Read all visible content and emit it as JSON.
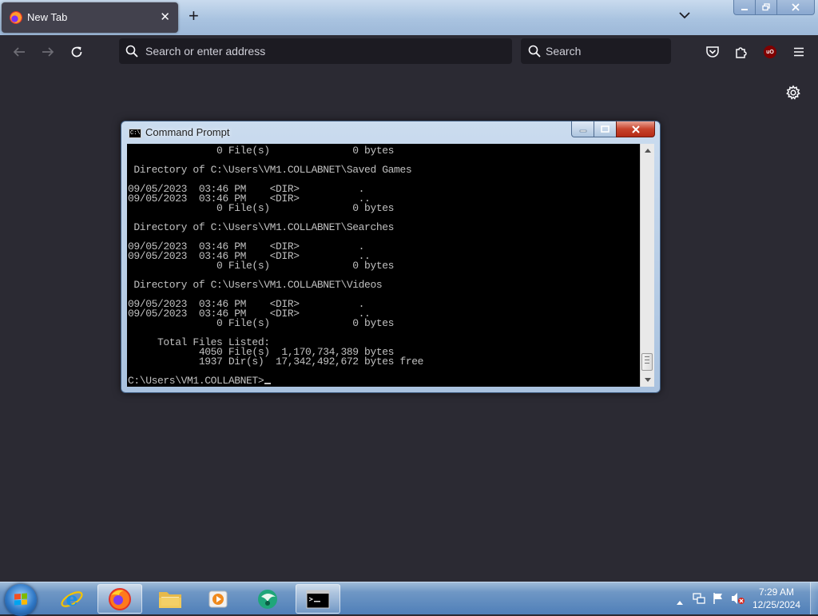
{
  "browser": {
    "tab": {
      "title": "New Tab"
    },
    "urlbar": {
      "placeholder": "Search or enter address"
    },
    "searchbar": {
      "placeholder": "Search"
    },
    "extension_badge": "uO",
    "colors": {
      "chrome": "#2b2a33",
      "field": "#1c1b22",
      "tab": "#42414d"
    }
  },
  "cmd": {
    "title": "Command Prompt",
    "icon_text": "C:\\",
    "lines": [
      "               0 File(s)              0 bytes",
      "",
      " Directory of C:\\Users\\VM1.COLLABNET\\Saved Games",
      "",
      "09/05/2023  03:46 PM    <DIR>          .",
      "09/05/2023  03:46 PM    <DIR>          ..",
      "               0 File(s)              0 bytes",
      "",
      " Directory of C:\\Users\\VM1.COLLABNET\\Searches",
      "",
      "09/05/2023  03:46 PM    <DIR>          .",
      "09/05/2023  03:46 PM    <DIR>          ..",
      "               0 File(s)              0 bytes",
      "",
      " Directory of C:\\Users\\VM1.COLLABNET\\Videos",
      "",
      "09/05/2023  03:46 PM    <DIR>          .",
      "09/05/2023  03:46 PM    <DIR>          ..",
      "               0 File(s)              0 bytes",
      "",
      "     Total Files Listed:",
      "            4050 File(s)  1,170,734,389 bytes",
      "            1937 Dir(s)  17,342,492,672 bytes free",
      ""
    ],
    "prompt": "C:\\Users\\VM1.COLLABNET>"
  },
  "taskbar": {
    "items": [
      {
        "name": "internet-explorer",
        "active": false
      },
      {
        "name": "firefox",
        "active": true
      },
      {
        "name": "file-explorer",
        "active": false
      },
      {
        "name": "media-player",
        "active": false
      },
      {
        "name": "app-green",
        "active": false
      },
      {
        "name": "command-prompt",
        "active": true
      }
    ],
    "clock": {
      "time": "7:29 AM",
      "date": "12/25/2024"
    }
  }
}
